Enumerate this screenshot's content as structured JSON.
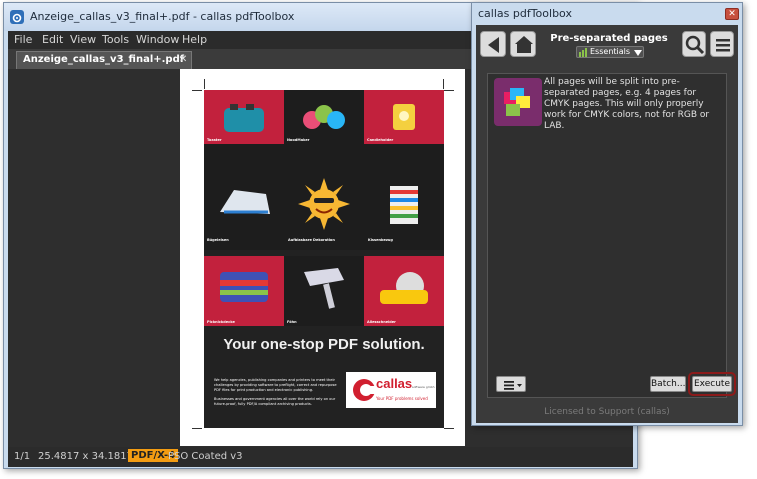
{
  "main_window": {
    "title": "Anzeige_callas_v3_final+.pdf - callas pdfToolbox",
    "menu": [
      "File",
      "Edit",
      "View",
      "Tools",
      "Window",
      "Help"
    ],
    "tab_label": "Anzeige_callas_v3_final+.pdf",
    "tab_close": "✕",
    "status": {
      "page": "1/1",
      "size": "25.4817 x 34.1817 cm",
      "pdfx": "PDF/X-4",
      "profile": "PSO Coated v3"
    }
  },
  "poster": {
    "products": [
      "Toaster",
      "NoodMaker",
      "Candleholder",
      "Bügeleisen",
      "Aufblasbare Dekoration",
      "Kissenbezug",
      "Picknickdecke",
      "Föhn",
      "Allesschneider"
    ],
    "slogan": "Your one-stop PDF solution.",
    "small_text_1": "We help agencies, publishing companies and printers to meet their challenges by providing software to preflight, correct and repurpose PDF files for print production and electronic publishing.",
    "small_text_2": "Businesses and government agencies all over the world rely on our future-proof, fully PDF/A compliant archiving products.",
    "logo_name": "callas",
    "logo_sub": "software gmbh",
    "logo_tag": "Your PDF problems solved"
  },
  "toolbox": {
    "title": "callas pdfToolbox",
    "close_glyph": "✕",
    "profile_name": "Pre-separated pages",
    "category": "Essentials",
    "description": "All pages will be split into pre-separated pages, e.g. 4 pages for CMYK pages. This will only properly work for CMYK colors, not for RGB or LAB.",
    "batch_label": "Batch...",
    "execute_label": "Execute",
    "license": "Licensed to Support (callas)"
  },
  "colors": {
    "poster_red": "#c2213d",
    "highlight": "#8b1a1a",
    "pdfx_badge": "#f39c12"
  },
  "icons": [
    "app-icon",
    "back-arrow-icon",
    "home-icon",
    "search-icon",
    "hamburger-menu-icon",
    "chart-icon",
    "profile-thumbnail-icon",
    "list-menu-icon"
  ]
}
